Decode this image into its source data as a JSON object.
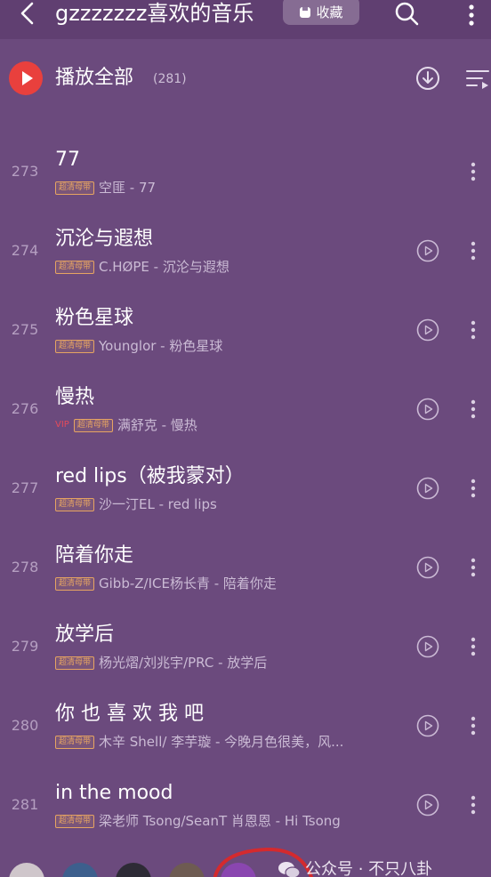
{
  "header": {
    "title": "gzzzzzzz喜欢的音乐",
    "collect_label": "收藏"
  },
  "play_all": {
    "label": "播放全部",
    "count": "(281)"
  },
  "songs": [
    {
      "index": "273",
      "title": "77",
      "quality_tag": "超清母带",
      "subtitle": "空匪 - 77",
      "mv_button": false
    },
    {
      "index": "274",
      "title": "沉沦与遐想",
      "quality_tag": "超清母带",
      "subtitle": "C.HØPE - 沉沦与遐想",
      "mv_button": true
    },
    {
      "index": "275",
      "title": "粉色星球",
      "quality_tag": "超清母带",
      "subtitle": "Younglor - 粉色星球",
      "mv_button": true
    },
    {
      "index": "276",
      "title": "慢热",
      "vip_badge": "VIP",
      "quality_tag": "超清母带",
      "subtitle": "满舒克 - 慢热",
      "mv_button": true
    },
    {
      "index": "277",
      "title": "red lips（被我蒙对）",
      "quality_tag": "超清母带",
      "subtitle": "沙一汀EL - red lips",
      "mv_button": true
    },
    {
      "index": "278",
      "title": "陪着你走",
      "quality_tag": "超清母带",
      "subtitle": "Gibb-Z/ICE杨长青 - 陪着你走",
      "mv_button": true
    },
    {
      "index": "279",
      "title": "放学后",
      "quality_tag": "超清母带",
      "subtitle": "杨光熠/刘兆宇/PRC - 放学后",
      "mv_button": true
    },
    {
      "index": "280",
      "title": "你 也 喜 欢 我 吧",
      "quality_tag": "超清母带",
      "subtitle": "木辛 Shell/ 李芋璇 - 今晚月色很美，风...",
      "mv_button": true
    },
    {
      "index": "281",
      "title": "in the mood",
      "quality_tag": "超清母带",
      "subtitle": "梁老师 Tsong/SeanT 肖恩恩 - Hi Tsong",
      "mv_button": true
    }
  ],
  "watermark": {
    "text": "公众号 · 不只八卦"
  },
  "icons": {
    "header": [
      "back-icon",
      "collect-icon",
      "search-icon",
      "more-vertical-icon"
    ],
    "play_all": [
      "play-all-icon",
      "download-icon",
      "multi-select-icon"
    ],
    "row": [
      "mv-play-icon",
      "more-vertical-icon"
    ],
    "footer": [
      "wechat-icon"
    ]
  },
  "colors": {
    "background": "#6b4a7d",
    "header": "#603f71",
    "accent": "#e9403d",
    "tag": "#e6a462",
    "vip": "#e34b5b"
  }
}
